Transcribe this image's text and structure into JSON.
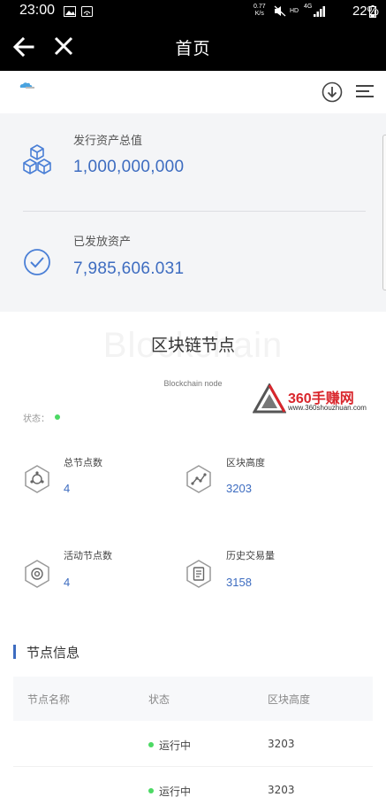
{
  "status_bar": {
    "time": "23:00",
    "net_speed_top": "0.77",
    "net_speed_bottom": "K/s",
    "signal_hd": "HD",
    "signal_4g": "4G",
    "battery": "22%"
  },
  "title_bar": {
    "title": "首页",
    "back_icon": "arrow-left-icon",
    "close_icon": "close-icon"
  },
  "header": {
    "logo_icon": "cloud-logo-icon",
    "download_icon": "download-circle-icon",
    "menu_icon": "hamburger-menu-icon"
  },
  "assets": {
    "total": {
      "label": "发行资产总值",
      "value": "1,000,000,000",
      "icon": "cubes-icon"
    },
    "issued": {
      "label": "已发放资产",
      "value": "7,985,606.031",
      "icon": "check-circle-icon"
    }
  },
  "blockchain": {
    "bg_word": "Blockchain",
    "title": "区块链节点",
    "subtitle": "Blockchain node",
    "status_label": "状态：",
    "status_color": "#4cd964"
  },
  "watermark": {
    "text": "360手赚网",
    "url": "www.360shouzhuan.com"
  },
  "stats": [
    {
      "label": "总节点数",
      "value": "4",
      "icon": "node-hub-icon"
    },
    {
      "label": "区块高度",
      "value": "3203",
      "icon": "chart-line-icon"
    },
    {
      "label": "活动节点数",
      "value": "4",
      "icon": "active-node-icon"
    },
    {
      "label": "历史交易量",
      "value": "3158",
      "icon": "receipt-icon"
    }
  ],
  "nodes": {
    "title": "节点信息",
    "headers": [
      "节点名称",
      "状态",
      "区块高度"
    ],
    "rows": [
      {
        "name": "",
        "status": "运行中",
        "height": "3203"
      },
      {
        "name": "",
        "status": "运行中",
        "height": "3203"
      }
    ]
  },
  "colors": {
    "accent": "#3d6cc0",
    "running": "#4cd964"
  }
}
